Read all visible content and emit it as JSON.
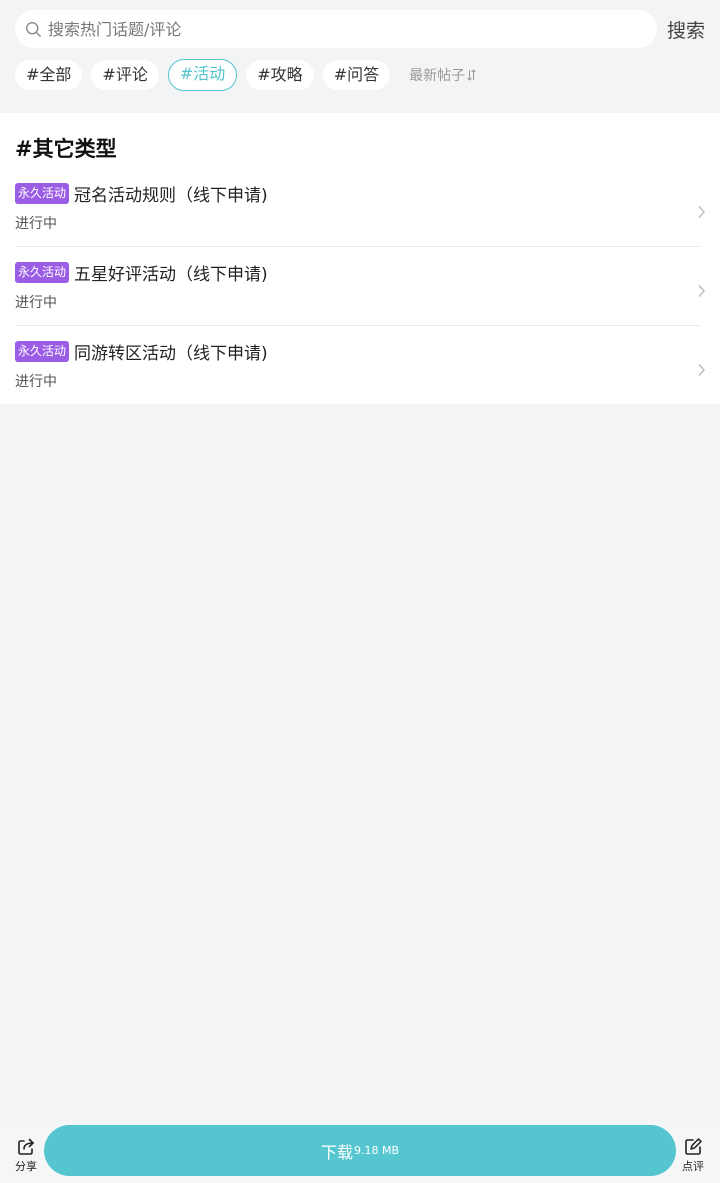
{
  "search": {
    "placeholder": "搜索热门话题/评论",
    "button_label": "搜索"
  },
  "filters": {
    "chips": [
      "#全部",
      "#评论",
      "#活动",
      "#攻略",
      "#问答"
    ],
    "active_index": 2,
    "sort_label": "最新帖子"
  },
  "section": {
    "title": "#其它类型",
    "items": [
      {
        "badge": "永久活动",
        "title": "冠名活动规则（线下申请)",
        "status": "进行中"
      },
      {
        "badge": "永久活动",
        "title": "五星好评活动（线下申请)",
        "status": "进行中"
      },
      {
        "badge": "永久活动",
        "title": "同游转区活动（线下申请)",
        "status": "进行中"
      }
    ]
  },
  "bottom": {
    "share_label": "分享",
    "download_label": "下载",
    "download_size": "9.18 MB",
    "review_label": "点评"
  },
  "colors": {
    "accent": "#55c6cf",
    "badge": "#9b5de5",
    "background": "#f3f4f6"
  },
  "icons": [
    "search-icon",
    "sort-icon",
    "chevron-right-icon",
    "share-icon",
    "edit-icon"
  ]
}
